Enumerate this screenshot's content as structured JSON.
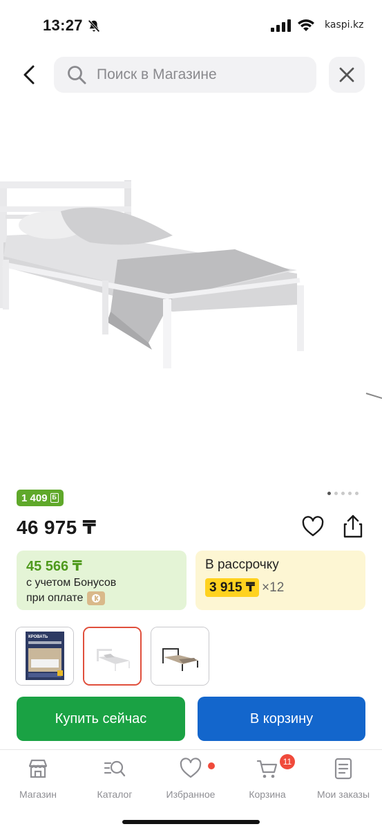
{
  "status_bar": {
    "time": "13:27",
    "watermark": "kaspi.kz"
  },
  "header": {
    "search_placeholder": "Поиск в Магазине"
  },
  "product": {
    "bonus_badge": "1 409",
    "price": "46 975 ₸",
    "gallery_dots": 5,
    "gallery_active_dot": 1
  },
  "bonus_card": {
    "price": "45 566 ₸",
    "line1": "с учетом Бонусов",
    "line2": "при оплате"
  },
  "credit_card": {
    "title": "В рассрочку",
    "monthly": "3 915 ₸",
    "multiplier": "×12"
  },
  "thumbnails": [
    {
      "icon": "product-collage-thumbnail",
      "caption": "КРОВАТЬ"
    },
    {
      "icon": "white-bed-thumbnail"
    },
    {
      "icon": "black-bed-thumbnail"
    }
  ],
  "actions": {
    "buy_now": "Купить сейчас",
    "to_cart": "В корзину"
  },
  "bottom_nav": {
    "shop": "Магазин",
    "catalog": "Каталог",
    "favorites": "Избранное",
    "cart": "Корзина",
    "cart_badge": "11",
    "orders": "Мои заказы"
  },
  "colors": {
    "bonus_green": "#5fa82a",
    "buy_green": "#1aa244",
    "cart_blue": "#1366cc",
    "installment_yellow": "#ffd21f",
    "badge_red": "#f04a3b"
  }
}
